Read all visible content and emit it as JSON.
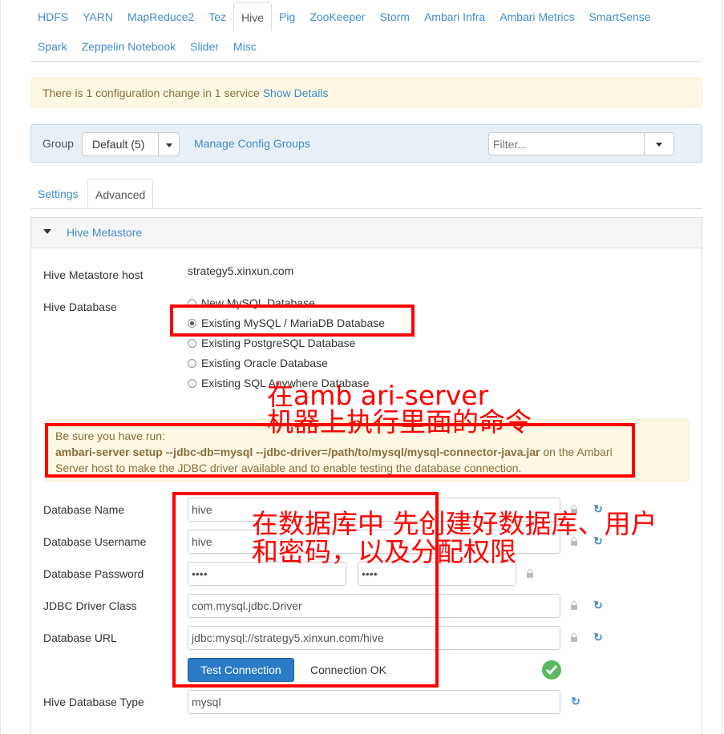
{
  "service_tabs_row1": [
    "HDFS",
    "YARN",
    "MapReduce2",
    "Tez",
    "Hive",
    "Pig",
    "ZooKeeper",
    "Storm",
    "Ambari Infra",
    "Ambari Metrics",
    "SmartSense"
  ],
  "service_tabs_row2": [
    "Spark",
    "Zeppelin Notebook",
    "Slider",
    "Misc"
  ],
  "active_service": "Hive",
  "alert": {
    "text": "There is 1 configuration change in 1 service",
    "link": "Show Details"
  },
  "group": {
    "label": "Group",
    "selected": "Default (5)",
    "manage_link": "Manage Config Groups",
    "filter_placeholder": "Filter..."
  },
  "sub_tabs": {
    "settings": "Settings",
    "advanced": "Advanced"
  },
  "section": {
    "title": "Hive Metastore"
  },
  "metastore": {
    "host_label": "Hive Metastore host",
    "host_value": "strategy5.xinxun.com",
    "db_label": "Hive Database",
    "db_options": [
      "New MySQL Database",
      "Existing MySQL / MariaDB Database",
      "Existing PostgreSQL Database",
      "Existing Oracle Database",
      "Existing SQL Anywhere Database"
    ],
    "db_selected": "Existing MySQL / MariaDB Database"
  },
  "warning": {
    "line1": "Be sure you have run:",
    "command": "ambari-server setup --jdbc-db=mysql --jdbc-driver=/path/to/mysql/mysql-connector-java.jar",
    "line2_tail": " on the Ambari",
    "line3": "Server host to make the JDBC driver available and to enable testing the database connection."
  },
  "fields": {
    "db_name_label": "Database Name",
    "db_name": "hive",
    "db_user_label": "Database Username",
    "db_user": "hive",
    "db_pass_label": "Database Password",
    "db_pass": "••••",
    "db_pass_confirm": "••••",
    "jdbc_label": "JDBC Driver Class",
    "jdbc": "com.mysql.jdbc.Driver",
    "url_label": "Database URL",
    "url": "jdbc:mysql://strategy5.xinxun.com/hive",
    "db_type_label": "Hive Database Type",
    "db_type": "mysql"
  },
  "test": {
    "button": "Test Connection",
    "status": "Connection OK"
  },
  "annotations": {
    "note1_line1": "在amb ari-server",
    "note1_line2": "机器上执行里面的命令",
    "note2_line1": "在数据库中 先创建好数据库、用户",
    "note2_line2": "和密码，以及分配权限",
    "color": "#ff0000"
  },
  "icons": [
    "caret-down-icon",
    "radio-icon",
    "lock-icon",
    "refresh-icon",
    "check-circle-icon"
  ]
}
